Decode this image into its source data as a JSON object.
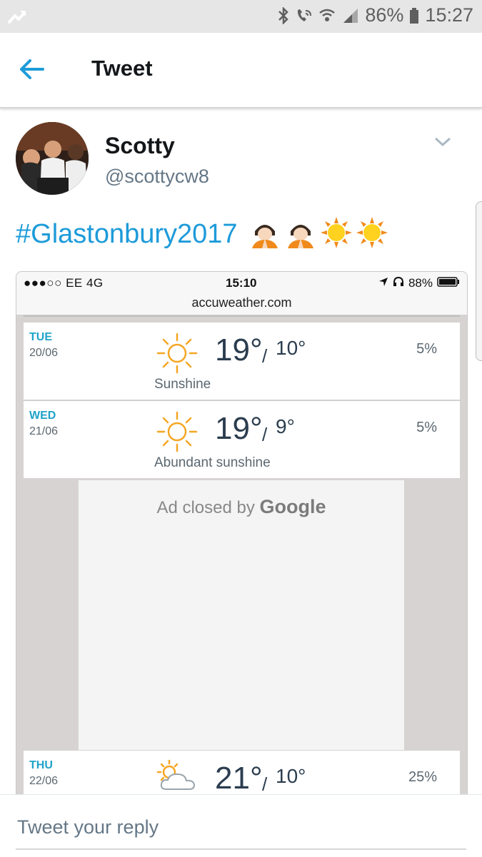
{
  "status_bar": {
    "battery": "86%",
    "time": "15:27"
  },
  "app_bar": {
    "back_icon": "arrow-left-icon",
    "title": "Tweet"
  },
  "tweet": {
    "user_name": "Scotty",
    "user_handle": "@scottycw8",
    "hashtag": "#Glastonbury2017",
    "emojis": [
      "person-praying-icon",
      "person-praying-icon",
      "sun-icon",
      "sun-icon"
    ]
  },
  "screenshot": {
    "carrier": "●●●○○ EE  4G",
    "time": "15:10",
    "battery": "88%",
    "url": "accuweather.com",
    "forecast": [
      {
        "dow": "TUE",
        "date": "20/06",
        "hi": "19°",
        "lo": "10°",
        "precip": "5%",
        "condition": "Sunshine",
        "icon": "sun-icon"
      },
      {
        "dow": "WED",
        "date": "21/06",
        "hi": "19°",
        "lo": "9°",
        "precip": "5%",
        "condition": "Abundant sunshine",
        "icon": "sun-icon"
      },
      {
        "dow": "THU",
        "date": "22/06",
        "hi": "21°",
        "lo": "10°",
        "precip": "25%",
        "condition": "",
        "icon": "partly-cloudy-icon"
      }
    ],
    "ad": {
      "prefix": "Ad closed by",
      "brand": "Google"
    }
  },
  "reply": {
    "placeholder": "Tweet your reply"
  },
  "colors": {
    "link_blue": "#1d9bd9",
    "accu_teal": "#1fa3c8",
    "sun_orange": "#f5a623"
  }
}
